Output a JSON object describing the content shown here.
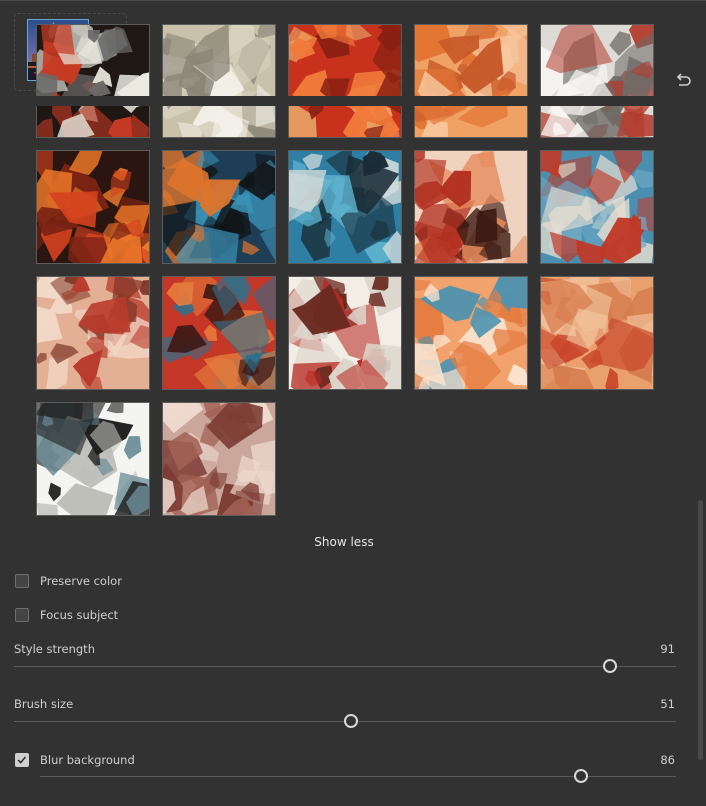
{
  "reference": {
    "thumbnail_icon": "big-ben-night-photo",
    "dropdown_icon": "chevron-down-icon",
    "reset_icon": "undo-icon"
  },
  "styles": [
    {
      "name": "style-1",
      "colors": [
        "#1f1714",
        "#c63a23",
        "#eaeae0",
        "#6a6a6a"
      ]
    },
    {
      "name": "style-2",
      "colors": [
        "#c9c1aa",
        "#f2f0e8",
        "#8b8678",
        "#d8d1bd"
      ]
    },
    {
      "name": "style-3",
      "colors": [
        "#c8321d",
        "#f07a3a",
        "#8a2012",
        "#e9a469"
      ]
    },
    {
      "name": "style-4",
      "colors": [
        "#f0a164",
        "#e37433",
        "#c85a2a",
        "#f7c79e"
      ]
    },
    {
      "name": "style-5",
      "colors": [
        "#dedbd6",
        "#f6f5f2",
        "#b23b2d",
        "#6d6a66"
      ]
    },
    {
      "name": "style-6",
      "colors": [
        "#2a1510",
        "#d4421f",
        "#f07a2a",
        "#7b2414"
      ]
    },
    {
      "name": "style-7",
      "colors": [
        "#1d3e55",
        "#e0742c",
        "#3b93b8",
        "#111417"
      ]
    },
    {
      "name": "style-8",
      "colors": [
        "#2f7ea3",
        "#1a2c36",
        "#5bb0cc",
        "#cfd9d8"
      ]
    },
    {
      "name": "style-9",
      "colors": [
        "#f0d3bf",
        "#b23122",
        "#3d1b14",
        "#e58a5a"
      ]
    },
    {
      "name": "style-10",
      "colors": [
        "#4a8fb0",
        "#e6ddd0",
        "#c23826",
        "#6fa8c5"
      ]
    },
    {
      "name": "style-11",
      "colors": [
        "#e3b095",
        "#b93a2c",
        "#f3d9c8",
        "#7e3527"
      ]
    },
    {
      "name": "style-12",
      "colors": [
        "#c43626",
        "#2f6f8c",
        "#e67b3c",
        "#3d1a15"
      ]
    },
    {
      "name": "style-13",
      "colors": [
        "#f2eee6",
        "#b82a22",
        "#6a2a20",
        "#dcd6cc"
      ]
    },
    {
      "name": "style-14",
      "colors": [
        "#f2a26c",
        "#e57c40",
        "#fbe3cf",
        "#4e93b0"
      ]
    },
    {
      "name": "style-15",
      "colors": [
        "#e9a06d",
        "#c8442b",
        "#f3c6a0",
        "#d57a4c"
      ]
    },
    {
      "name": "style-16",
      "colors": [
        "#f4f4f1",
        "#1d1d1d",
        "#6d8d98",
        "#bdbdb8"
      ]
    },
    {
      "name": "style-17",
      "colors": [
        "#caa69b",
        "#7b3a32",
        "#eed9cd",
        "#a26255"
      ]
    }
  ],
  "show_less_label": "Show less",
  "preserve_color": {
    "label": "Preserve color",
    "checked": false
  },
  "focus_subject": {
    "label": "Focus subject",
    "checked": false
  },
  "style_strength": {
    "label": "Style strength",
    "value": "91"
  },
  "brush_size": {
    "label": "Brush size",
    "value": "51"
  },
  "blur_background": {
    "label": "Blur background",
    "checked": true,
    "value": "86"
  }
}
